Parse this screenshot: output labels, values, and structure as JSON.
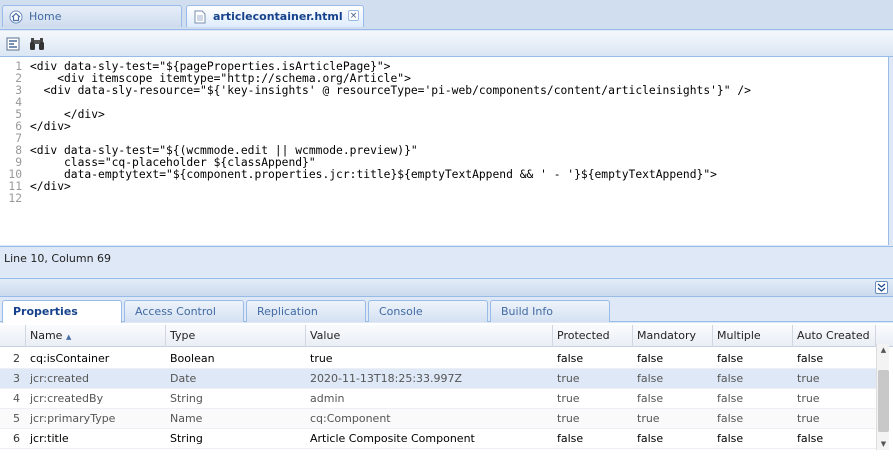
{
  "tabs": [
    {
      "label": "Home",
      "icon": "home-icon"
    },
    {
      "label": "articlecontainer.html",
      "icon": "file-icon",
      "close": "×"
    }
  ],
  "editor": {
    "lines": [
      {
        "num": "1",
        "text": "<div data-sly-test=\"${pageProperties.isArticlePage}\">"
      },
      {
        "num": "2",
        "text": "    <div itemscope itemtype=\"http://schema.org/Article\">"
      },
      {
        "num": "3",
        "text": "  <div data-sly-resource=\"${'key-insights' @ resourceType='pi-web/components/content/articleinsights'}\" />"
      },
      {
        "num": "4",
        "text": ""
      },
      {
        "num": "5",
        "text": "     </div>"
      },
      {
        "num": "6",
        "text": "</div>"
      },
      {
        "num": "7",
        "text": ""
      },
      {
        "num": "8",
        "text": "<div data-sly-test=\"${(wcmmode.edit || wcmmode.preview)}\""
      },
      {
        "num": "9",
        "text": "     class=\"cq-placeholder ${classAppend}\""
      },
      {
        "num": "10",
        "text": "     data-emptytext=\"${component.properties.jcr:title}${emptyTextAppend && ' - '}${emptyTextAppend}\">"
      },
      {
        "num": "11",
        "text": "</div>"
      },
      {
        "num": "12",
        "text": ""
      }
    ]
  },
  "status": {
    "text": "Line 10, Column 69"
  },
  "bottom_tabs": [
    "Properties",
    "Access Control",
    "Replication",
    "Console",
    "Build Info"
  ],
  "grid": {
    "columns": [
      "Name",
      "Type",
      "Value",
      "Protected",
      "Mandatory",
      "Multiple",
      "Auto Created"
    ],
    "sort_indicator": "▲",
    "rows": [
      {
        "n": "2",
        "name": "cq:isContainer",
        "type": "Boolean",
        "value": "true",
        "protected": "false",
        "mandatory": "false",
        "multiple": "false",
        "auto": "false"
      },
      {
        "n": "3",
        "name": "jcr:created",
        "type": "Date",
        "value": "2020-11-13T18:25:33.997Z",
        "protected": "true",
        "mandatory": "false",
        "multiple": "false",
        "auto": "true"
      },
      {
        "n": "4",
        "name": "jcr:createdBy",
        "type": "String",
        "value": "admin",
        "protected": "true",
        "mandatory": "false",
        "multiple": "false",
        "auto": "true"
      },
      {
        "n": "5",
        "name": "jcr:primaryType",
        "type": "Name",
        "value": "cq:Component",
        "protected": "true",
        "mandatory": "true",
        "multiple": "false",
        "auto": "true"
      },
      {
        "n": "6",
        "name": "jcr:title",
        "type": "String",
        "value": "Article Composite Component",
        "protected": "false",
        "mandatory": "false",
        "multiple": "false",
        "auto": "false"
      }
    ]
  },
  "colors": {
    "accent": "#15428b",
    "border": "#99bbe8",
    "panel": "#dfe8f6"
  }
}
